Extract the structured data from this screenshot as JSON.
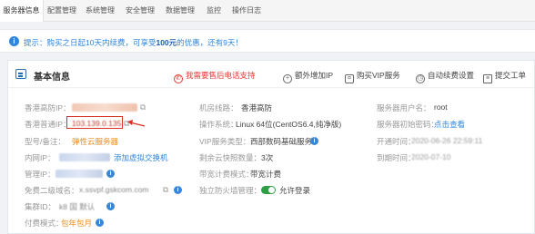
{
  "tabs": [
    "服务器信息",
    "配置管理",
    "系统管理",
    "安全管理",
    "数据管理",
    "监控",
    "操作日志"
  ],
  "notice": {
    "prefix": "提示：购买之日起10天内续费，可享受",
    "amount": "100元",
    "suffix": "的优惠，还有9天！"
  },
  "panel": {
    "title": "基本信息",
    "actions": {
      "phone_support": "我需要售后电话支持",
      "extra_ip": "额外增加IP",
      "vip": "购买VIP服务",
      "auto_renew": "自动续费设置",
      "ticket": "提交工单"
    }
  },
  "info": {
    "hk_ip_label": "香港高防IP：",
    "hk_normal_ip_label": "香港普通IP：",
    "hk_normal_ip_value": "103.139.0.135",
    "model_label": "型号/备注：",
    "model_value": "弹性云服务器",
    "lan_ip_label": "内网IP：",
    "lan_link": "添加虚拟交换机",
    "mgmt_ip_label": "管理IP：",
    "domain_label": "免费二级域名：",
    "domain_value": "x.ssvpf.gskcom.com",
    "cluster_label": "集群ID：",
    "cluster_value": "k8 国 默认",
    "pay_label": "付费模式：",
    "pay_value": "包年包月",
    "room_label": "机房线路：",
    "room_value": "香港高防",
    "os_label": "操作系统：",
    "os_value": "Linux 64位(CentOS6.4,纯净版)",
    "vip_label": "VIP服务类型：",
    "vip_value": "西部数码基础服务",
    "snapshot_label": "剩余云快照数量：",
    "snapshot_value": "3次",
    "bandwidth_label": "带宽计费模式：",
    "bandwidth_value": "带宽计费",
    "firewall_label": "独立防火墙管理：",
    "firewall_value": "允许登录",
    "user_label": "服务器用户名：",
    "user_value": "root",
    "pass_label": "服务器初始密码：",
    "pass_link": "点击查看",
    "open_label": "开通时间：",
    "open_value": "2020-06-26 22:59:11",
    "expire_label": "到期时间：",
    "expire_value": "2020-07-10"
  },
  "colors": {
    "accent": "#2e86de",
    "highlight": "#d93025",
    "warn": "#ee8b1b",
    "danger": "#e53935"
  }
}
